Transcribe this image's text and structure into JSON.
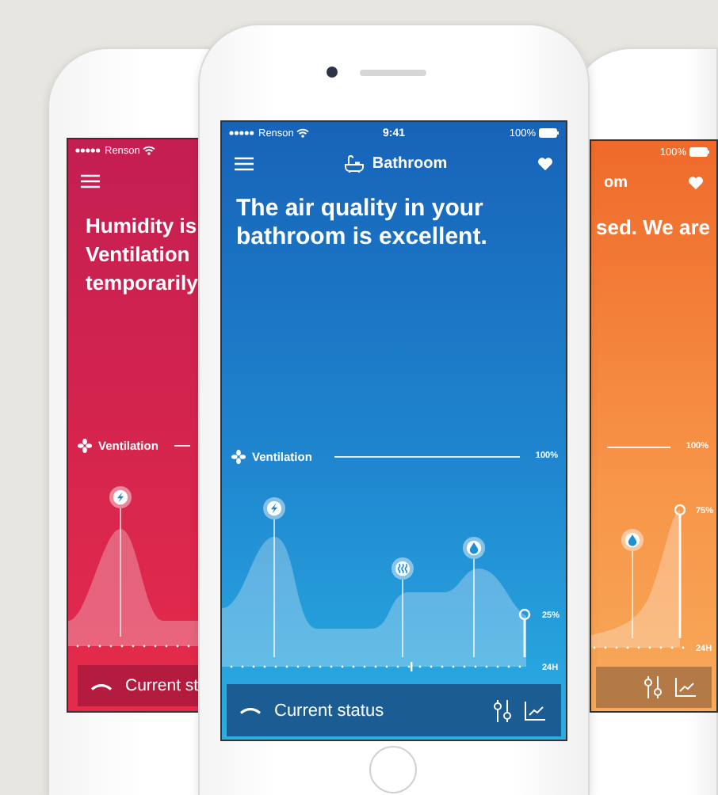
{
  "phones": [
    {
      "status_bar": {
        "carrier": "Renson"
      },
      "headline": [
        "Humidity is",
        "Ventilation",
        "temporarily"
      ],
      "ventilation": {
        "label": "Ventilation"
      },
      "chart": {
        "events": [
          {
            "kind": "boost"
          }
        ]
      },
      "footer": {
        "label": "Current st"
      }
    },
    {
      "status_bar": {
        "carrier": "Renson",
        "time": "9:41",
        "battery": "100%"
      },
      "header": {
        "title": "Bathroom",
        "favorite": true
      },
      "headline": [
        "The air quality in your",
        "bathroom is excellent."
      ],
      "ventilation": {
        "label": "Ventilation",
        "max": "100%"
      },
      "chart": {
        "events": [
          {
            "kind": "boost"
          },
          {
            "kind": "heat"
          },
          {
            "kind": "humidity"
          }
        ],
        "level_label": "25%",
        "time_label": "24H"
      },
      "footer": {
        "label": "Current status"
      }
    },
    {
      "status_bar": {
        "battery": "100%"
      },
      "header": {
        "title": "om",
        "favorite": true
      },
      "headline": [
        "sed. We are"
      ],
      "ventilation": {
        "max": "100%"
      },
      "chart": {
        "events": [
          {
            "kind": "humidity"
          }
        ],
        "level_label": "75%",
        "time_label": "24H"
      }
    }
  ]
}
